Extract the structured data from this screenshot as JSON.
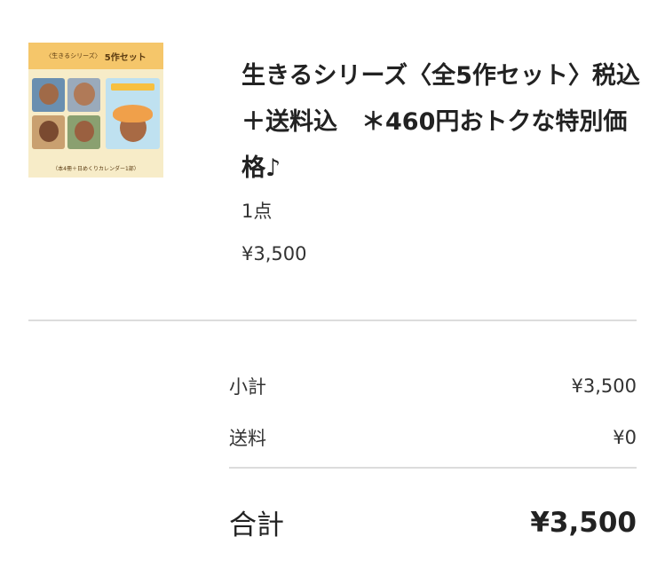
{
  "product": {
    "thumbnail": {
      "header_small": "〈生きるシリーズ〉",
      "header_large": "5作セット",
      "footer": "（本4冊＋日めくりカレンダー1部）"
    },
    "title": "生きるシリーズ〈全5作セット〉税込＋送料込　＊460円おトクな特別価格♪",
    "quantity": "1点",
    "price": "¥3,500"
  },
  "summary": {
    "subtotal_label": "小計",
    "subtotal_value": "¥3,500",
    "shipping_label": "送料",
    "shipping_value": "¥0",
    "total_label": "合計",
    "total_value": "¥3,500"
  }
}
